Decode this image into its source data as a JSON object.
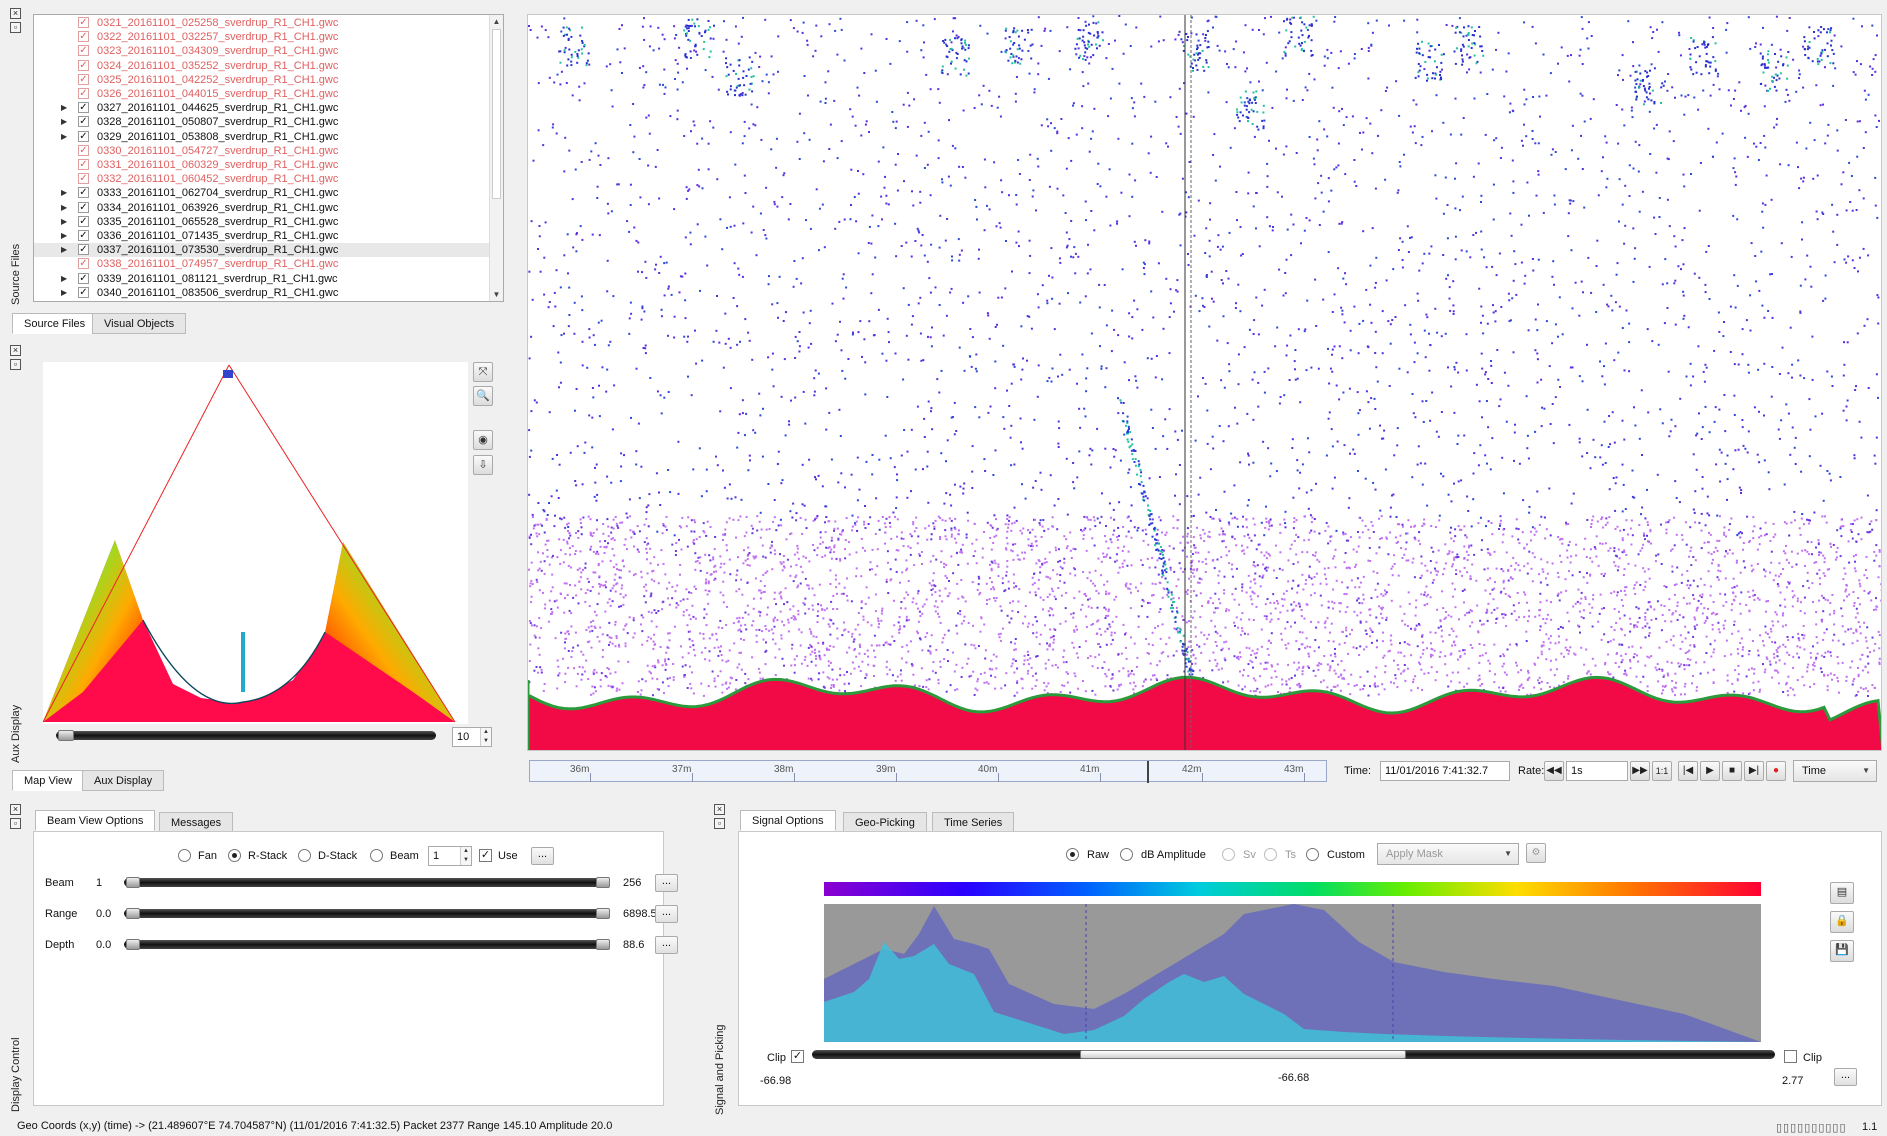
{
  "panels": {
    "source_files_label": "Source Files",
    "aux_display_label": "Aux Display",
    "display_control_label": "Display Control",
    "signal_picking_label": "Signal and Picking"
  },
  "source_files": {
    "tabs": [
      "Source Files",
      "Visual Objects"
    ],
    "files": [
      {
        "name": "0321_20161101_025258_sverdrup_R1_CH1.gwc",
        "enabled": false,
        "expandable": false
      },
      {
        "name": "0322_20161101_032257_sverdrup_R1_CH1.gwc",
        "enabled": false,
        "expandable": false
      },
      {
        "name": "0323_20161101_034309_sverdrup_R1_CH1.gwc",
        "enabled": false,
        "expandable": false
      },
      {
        "name": "0324_20161101_035252_sverdrup_R1_CH1.gwc",
        "enabled": false,
        "expandable": false
      },
      {
        "name": "0325_20161101_042252_sverdrup_R1_CH1.gwc",
        "enabled": false,
        "expandable": false
      },
      {
        "name": "0326_20161101_044015_sverdrup_R1_CH1.gwc",
        "enabled": false,
        "expandable": false
      },
      {
        "name": "0327_20161101_044625_sverdrup_R1_CH1.gwc",
        "enabled": true,
        "expandable": true
      },
      {
        "name": "0328_20161101_050807_sverdrup_R1_CH1.gwc",
        "enabled": true,
        "expandable": true
      },
      {
        "name": "0329_20161101_053808_sverdrup_R1_CH1.gwc",
        "enabled": true,
        "expandable": true
      },
      {
        "name": "0330_20161101_054727_sverdrup_R1_CH1.gwc",
        "enabled": false,
        "expandable": false
      },
      {
        "name": "0331_20161101_060329_sverdrup_R1_CH1.gwc",
        "enabled": false,
        "expandable": false
      },
      {
        "name": "0332_20161101_060452_sverdrup_R1_CH1.gwc",
        "enabled": false,
        "expandable": false
      },
      {
        "name": "0333_20161101_062704_sverdrup_R1_CH1.gwc",
        "enabled": true,
        "expandable": true
      },
      {
        "name": "0334_20161101_063926_sverdrup_R1_CH1.gwc",
        "enabled": true,
        "expandable": true
      },
      {
        "name": "0335_20161101_065528_sverdrup_R1_CH1.gwc",
        "enabled": true,
        "expandable": true
      },
      {
        "name": "0336_20161101_071435_sverdrup_R1_CH1.gwc",
        "enabled": true,
        "expandable": true
      },
      {
        "name": "0337_20161101_073530_sverdrup_R1_CH1.gwc",
        "enabled": true,
        "expandable": true,
        "selected": true
      },
      {
        "name": "0338_20161101_074957_sverdrup_R1_CH1.gwc",
        "enabled": false,
        "expandable": false
      },
      {
        "name": "0339_20161101_081121_sverdrup_R1_CH1.gwc",
        "enabled": true,
        "expandable": true
      },
      {
        "name": "0340_20161101_083506_sverdrup_R1_CH1.gwc",
        "enabled": true,
        "expandable": true
      }
    ]
  },
  "aux": {
    "tabs": [
      "Map View",
      "Aux Display"
    ],
    "slider_value": "10"
  },
  "timeline": {
    "ticks": [
      "36m",
      "37m",
      "38m",
      "39m",
      "40m",
      "41m",
      "42m",
      "43m"
    ],
    "time_label": "Time:",
    "time_value": "11/01/2016 7:41:32.7",
    "rate_label": "Rate:",
    "rate_value": "1s",
    "ratio_label": "1:1",
    "mode": "Time"
  },
  "beam_view": {
    "tabs": [
      "Beam View Options",
      "Messages"
    ],
    "modes": [
      "Fan",
      "R-Stack",
      "D-Stack",
      "Beam"
    ],
    "selected_mode": "R-Stack",
    "beam_number": "1",
    "use_label": "Use",
    "more": "...",
    "rows": [
      {
        "label": "Beam",
        "min": "1",
        "max": "256"
      },
      {
        "label": "Range",
        "min": "0.0",
        "max": "6898.5"
      },
      {
        "label": "Depth",
        "min": "0.0",
        "max": "88.6"
      }
    ]
  },
  "signal": {
    "tabs": [
      "Signal Options",
      "Geo-Picking",
      "Time Series"
    ],
    "modes": [
      "Raw",
      "dB Amplitude",
      "Sv",
      "Ts",
      "Custom"
    ],
    "selected_mode": "Raw",
    "mask_placeholder": "Apply Mask",
    "clip_label": "Clip",
    "clip_left_value": "-66.98",
    "clip_center_value": "-66.68",
    "clip_right_value": "2.77"
  },
  "status": {
    "text": "Geo Coords (x,y) (time) -> (21.489607°E 74.704587°N)  (11/01/2016 7:41:32.5)  Packet 2377 Range  145.10  Amplitude     20.0",
    "version": "1.1"
  }
}
